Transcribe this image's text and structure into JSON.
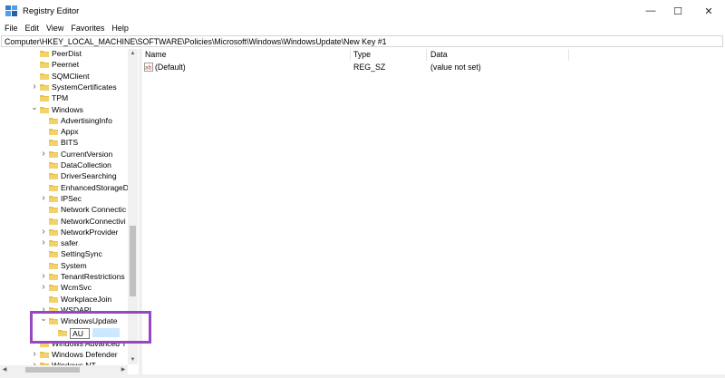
{
  "window": {
    "title": "Registry Editor",
    "minimize_glyph": "—",
    "maximize_glyph": "☐",
    "close_glyph": "✕"
  },
  "menu": [
    "File",
    "Edit",
    "View",
    "Favorites",
    "Help"
  ],
  "address": "Computer\\HKEY_LOCAL_MACHINE\\SOFTWARE\\Policies\\Microsoft\\Windows\\WindowsUpdate\\New Key #1",
  "tree": [
    {
      "label": "PeerDist",
      "expander": ""
    },
    {
      "label": "Peernet",
      "expander": ""
    },
    {
      "label": "SQMClient",
      "expander": ""
    },
    {
      "label": "SystemCertificates",
      "expander": ">"
    },
    {
      "label": "TPM",
      "expander": ""
    },
    {
      "label": "Windows",
      "expander": "v"
    },
    {
      "label": "AdvertisingInfo",
      "expander": ""
    },
    {
      "label": "Appx",
      "expander": ""
    },
    {
      "label": "BITS",
      "expander": ""
    },
    {
      "label": "CurrentVersion",
      "expander": ">"
    },
    {
      "label": "DataCollection",
      "expander": ""
    },
    {
      "label": "DriverSearching",
      "expander": ""
    },
    {
      "label": "EnhancedStorageD",
      "expander": ""
    },
    {
      "label": "IPSec",
      "expander": ">"
    },
    {
      "label": "Network Connectic",
      "expander": ""
    },
    {
      "label": "NetworkConnectivi",
      "expander": ""
    },
    {
      "label": "NetworkProvider",
      "expander": ">"
    },
    {
      "label": "safer",
      "expander": ">"
    },
    {
      "label": "SettingSync",
      "expander": ""
    },
    {
      "label": "System",
      "expander": ""
    },
    {
      "label": "TenantRestrictions",
      "expander": ">"
    },
    {
      "label": "WcmSvc",
      "expander": ">"
    },
    {
      "label": "WorkplaceJoin",
      "expander": ""
    },
    {
      "label": "WSDAPI",
      "expander": ">"
    },
    {
      "label": "WindowsUpdate",
      "expander": "v"
    },
    {
      "label": "AU",
      "expander": ""
    },
    {
      "label": "Windows Advanced T",
      "expander": ""
    },
    {
      "label": "Windows Defender",
      "expander": ">"
    },
    {
      "label": "Windows NT",
      "expander": ">"
    }
  ],
  "columns": {
    "name": "Name",
    "type": "Type",
    "data": "Data"
  },
  "values": [
    {
      "name": "(Default)",
      "type": "REG_SZ",
      "data": "(value not set)"
    }
  ],
  "colors": {
    "folder": "#e8c14a",
    "highlight": "#9747c2",
    "selection": "#cce8ff"
  }
}
